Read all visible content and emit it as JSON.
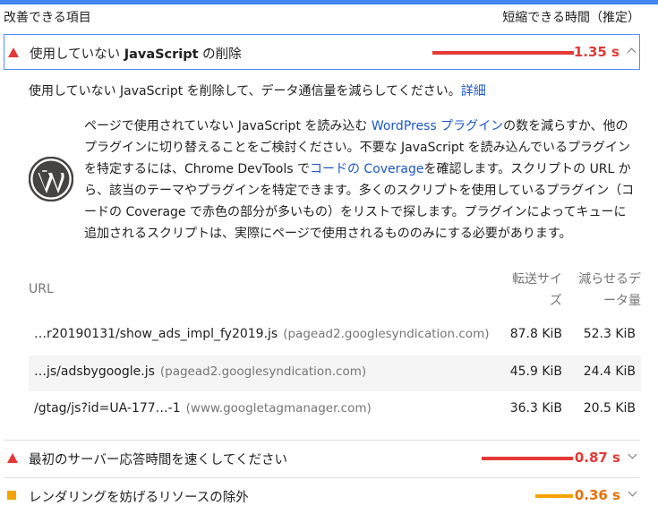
{
  "header": {
    "left": "改善できる項目",
    "right": "短縮できる時間（推定）"
  },
  "audits": [
    {
      "title_prefix": "使用していない ",
      "title_bold": "JavaScript",
      "title_suffix": " の削除",
      "value": "1.35 s",
      "color": "#e53935",
      "severity": "fail",
      "level": 0.9
    },
    {
      "title": "最初のサーバー応答時間を速くしてください",
      "value": "0.87 s",
      "color": "#e53935",
      "severity": "fail",
      "level": 0.58
    },
    {
      "title": "レンダリングを妨げるリソースの除外",
      "value": "0.36 s",
      "color": "#e8710a",
      "severity": "average",
      "level": 0.24
    }
  ],
  "description": {
    "text": "使用していない JavaScript を削除して、データ通信量を減らしてください。",
    "link": "詳細"
  },
  "tip": {
    "logo": "wordpress-logo",
    "p1": "ページで使用されていない JavaScript を読み込む ",
    "link1": "WordPress プラグイン",
    "p2": "の数を減らすか、他のプラグインに切り替えることをご検討ください。不要な JavaScript を読み込んでいるプラグインを特定するには、Chrome DevTools で",
    "link2": "コードの Coverage",
    "p3": "を確認します。スクリプトの URL から、該当のテーマやプラグインを特定できます。多くのスクリプトを使用しているプラグイン（コードの Coverage で赤色の部分が多いもの）をリストで探します。プラグインによってキューに追加されるスクリプトは、実際にページで使用されるもののみにする必要があります。"
  },
  "table": {
    "headers": {
      "url": "URL",
      "size_l1": "転送サイ",
      "size_l2": "ズ",
      "save_l1": "減らせるデ",
      "save_l2": "ータ量"
    },
    "rows": [
      {
        "url": "…r20190131/show_ads_impl_fy2019.js",
        "host": "(pagead2.googlesyndication.com)",
        "size": "87.8 KiB",
        "save": "52.3 KiB"
      },
      {
        "url": "…js/adsbygoogle.js",
        "host": "(pagead2.googlesyndication.com)",
        "size": "45.9 KiB",
        "save": "24.4 KiB"
      },
      {
        "url": "/gtag/js?id=UA-177…-1",
        "host": "(www.googletagmanager.com)",
        "size": "36.3 KiB",
        "save": "20.5 KiB"
      }
    ]
  },
  "colors": {
    "accent": "#4285f4",
    "fail": "#e53935",
    "average": "#f4a300",
    "link": "#1a57c5"
  }
}
